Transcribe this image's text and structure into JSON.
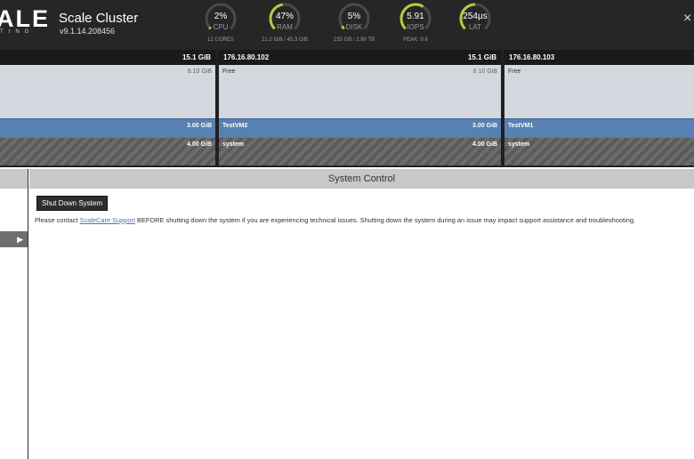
{
  "header": {
    "logo_text": "ALE",
    "logo_subtext": "TING",
    "cluster_name": "Scale Cluster",
    "version": "v9.1.14.208456",
    "close_glyph": "×",
    "gauges": [
      {
        "id": "cpu",
        "value": "2%",
        "label": "CPU",
        "sub": "12 CORES",
        "fill": 0.02
      },
      {
        "id": "ram",
        "value": "47%",
        "label": "RAM",
        "sub": "21.2 GiB / 45.3 GiB",
        "fill": 0.47
      },
      {
        "id": "disk",
        "value": "5%",
        "label": "DISK",
        "sub": "155 GB / 2.90 TB",
        "fill": 0.05
      },
      {
        "id": "iops",
        "value": "5.91",
        "label": "IOPS",
        "sub": "PEAK: 9.6",
        "fill": 0.62
      },
      {
        "id": "lat",
        "value": "254µs",
        "label": "LAT",
        "sub": "",
        "fill": 0.5
      }
    ],
    "gauge_color": "#b5c94a"
  },
  "nodes": [
    {
      "ip": "",
      "capacity": "15.1 GiB",
      "free_label": "",
      "free_size": "8.10 GiB",
      "vm_name": "",
      "vm_size": "3.00 GiB",
      "sys_label": "",
      "sys_size": "4.00 GiB"
    },
    {
      "ip": "176.16.80.102",
      "capacity": "15.1 GiB",
      "free_label": "Free",
      "free_size": "8.10 GiB",
      "vm_name": "TestVM2",
      "vm_size": "3.00 GiB",
      "sys_label": "system",
      "sys_size": "4.00 GiB"
    },
    {
      "ip": "176.16.80.103",
      "capacity": "",
      "free_label": "Free",
      "free_size": "",
      "vm_name": "TestVM1",
      "vm_size": "",
      "sys_label": "system",
      "sys_size": ""
    }
  ],
  "sidebar": {
    "arrow": "▶"
  },
  "main": {
    "title": "System Control",
    "shutdown_label": "Shut Down System",
    "notice_before": "Please contact ",
    "notice_link": "ScaleCare Support",
    "notice_after": " BEFORE shutting down the system if you are experiencing technical issues. Shutting down the system during an issue may impact support assistance and troubleshooting."
  },
  "colors": {
    "header_bg": "#262626",
    "free": "#d4d8de",
    "vm": "#5880b0",
    "system": "#606060"
  }
}
